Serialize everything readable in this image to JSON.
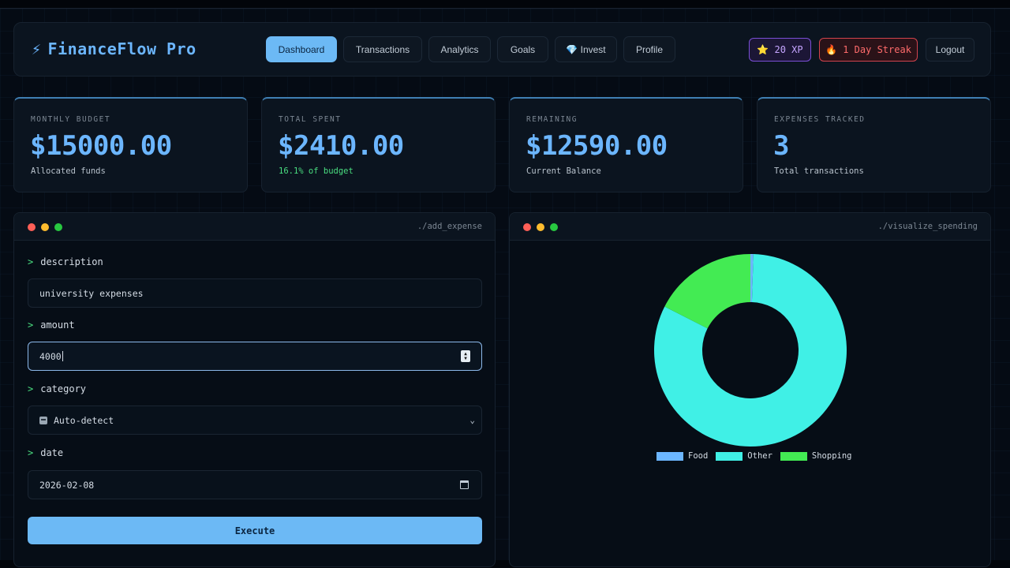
{
  "header": {
    "brand_icon": "⚡",
    "brand": "FinanceFlow Pro",
    "nav": [
      {
        "label": "Dashboard",
        "active": true
      },
      {
        "label": "Transactions",
        "active": false
      },
      {
        "label": "Analytics",
        "active": false
      },
      {
        "label": "Goals",
        "active": false
      },
      {
        "label": "💎 Invest",
        "active": false
      },
      {
        "label": "Profile",
        "active": false
      }
    ],
    "xp_badge": "⭐ 20 XP",
    "streak_badge": "🔥 1 Day Streak",
    "logout": "Logout"
  },
  "stats": [
    {
      "label": "MONTHLY BUDGET",
      "value": "$15000.00",
      "sub": "Allocated funds"
    },
    {
      "label": "TOTAL SPENT",
      "value": "$2410.00",
      "sub": "16.1% of budget"
    },
    {
      "label": "REMAINING",
      "value": "$12590.00",
      "sub": "Current Balance"
    },
    {
      "label": "EXPENSES TRACKED",
      "value": "3",
      "sub": "Total transactions"
    }
  ],
  "form": {
    "path": "./add_expense",
    "prompt": ">",
    "description_label": "description",
    "description_value": "university expenses",
    "amount_label": "amount",
    "amount_value": "4000",
    "category_label": "category",
    "category_value": "Auto-detect",
    "date_label": "date",
    "date_value": "2026-02-08",
    "execute_label": "Execute"
  },
  "viz": {
    "path": "./visualize_spending"
  },
  "chart_data": {
    "type": "pie",
    "title": "",
    "categories": [
      "Food",
      "Other",
      "Shopping"
    ],
    "values": [
      0.5,
      82,
      17.5
    ],
    "colors": [
      "#6cb6ff",
      "#40f0e6",
      "#43eb53"
    ],
    "legend": "bottom"
  }
}
